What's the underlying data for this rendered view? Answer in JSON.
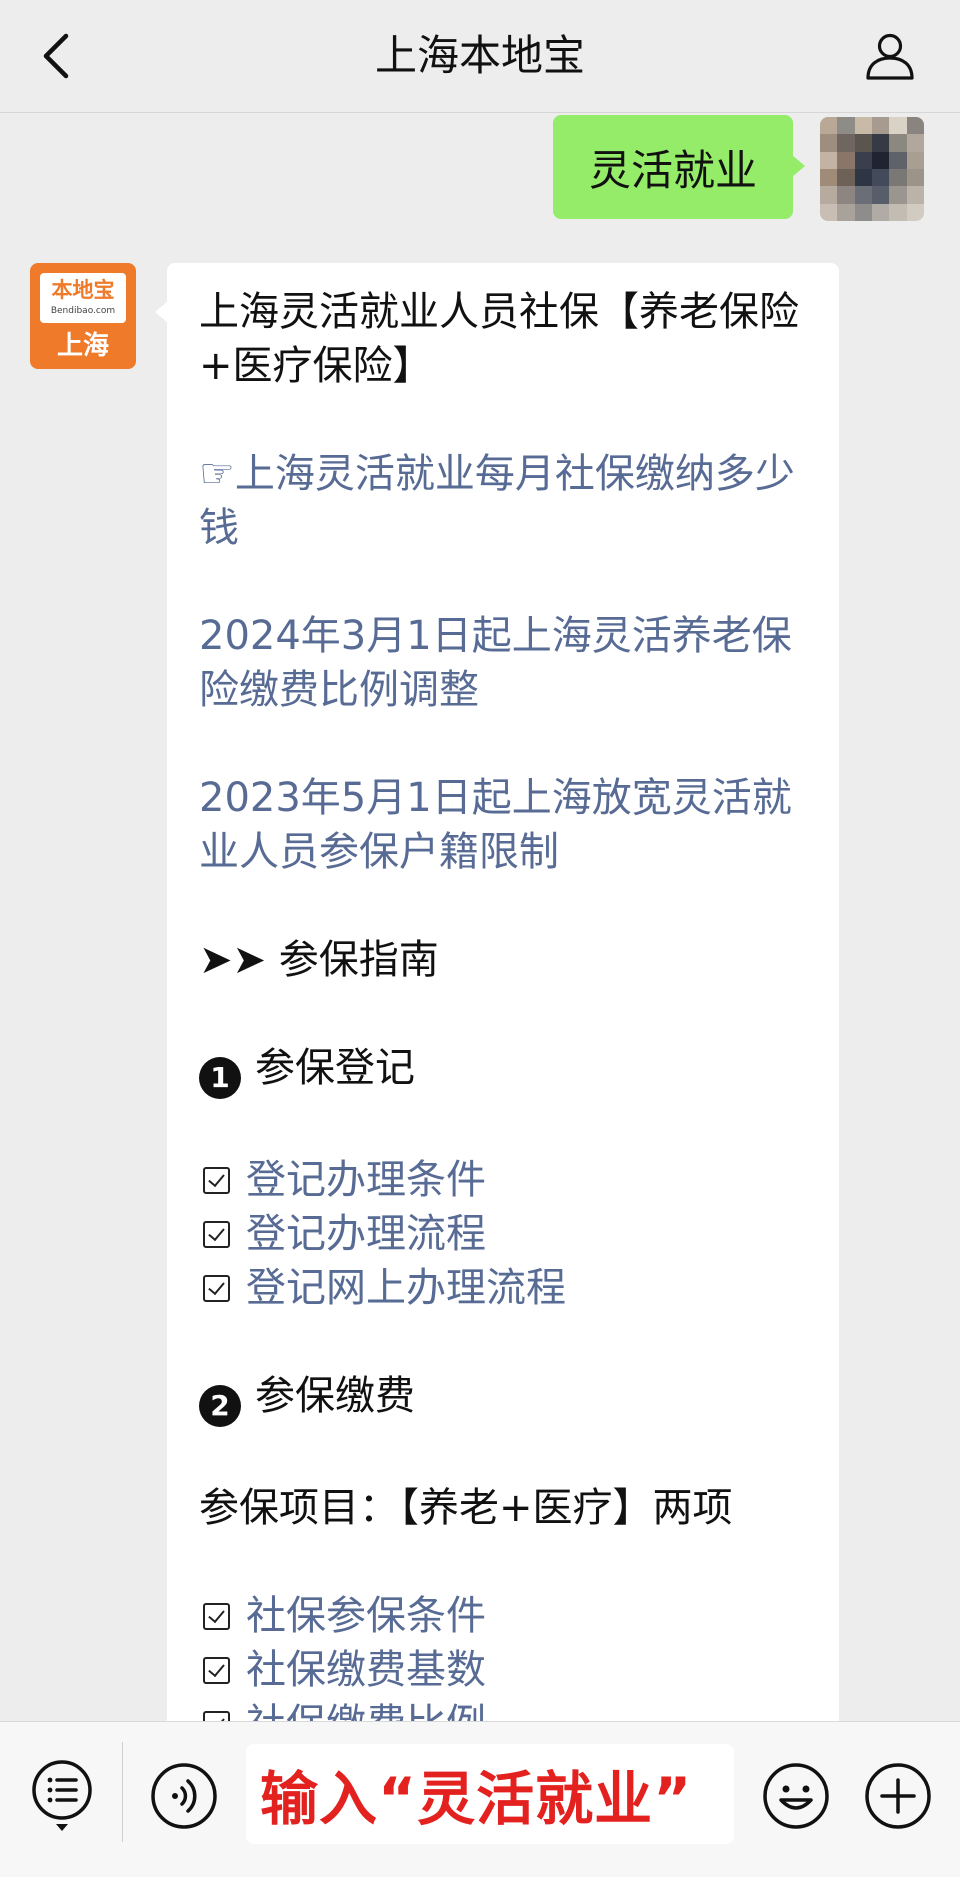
{
  "header": {
    "title": "上海本地宝",
    "back_icon": "chevron-left-icon",
    "profile_icon": "person-icon"
  },
  "user_message": {
    "text": "灵活就业"
  },
  "bot_avatar": {
    "name_cn": "本地宝",
    "name_en": "Bendibao.com",
    "city": "上海"
  },
  "bot_message": {
    "title": "上海灵活就业人员社保【养老保险+医疗保险】",
    "links": [
      "☞上海灵活就业每月社保缴纳多少钱",
      "2024年3月1日起上海灵活养老保险缴费比例调整",
      "2023年5月1日起上海放宽灵活就业人员参保户籍限制"
    ],
    "guide_heading": "➤➤ 参保指南",
    "section1": {
      "number": "1",
      "title": "参保登记",
      "items": [
        "登记办理条件",
        "登记办理流程",
        "登记网上办理流程"
      ]
    },
    "section2": {
      "number": "2",
      "title": "参保缴费",
      "project_line": "参保项目：【养老+医疗】两项",
      "items": [
        "社保参保条件",
        "社保缴费基数",
        "社保缴费比例"
      ]
    }
  },
  "bottom_bar": {
    "input_value": "输入“灵活就业”",
    "menu_icon": "menu-list-icon",
    "voice_icon": "voice-icon",
    "emoji_icon": "emoji-icon",
    "plus_icon": "plus-icon"
  },
  "colors": {
    "background": "#ededed",
    "user_bubble": "#95ec69",
    "link": "#576b95",
    "brand_orange": "#ee7a2a",
    "input_text": "#e3211f"
  }
}
